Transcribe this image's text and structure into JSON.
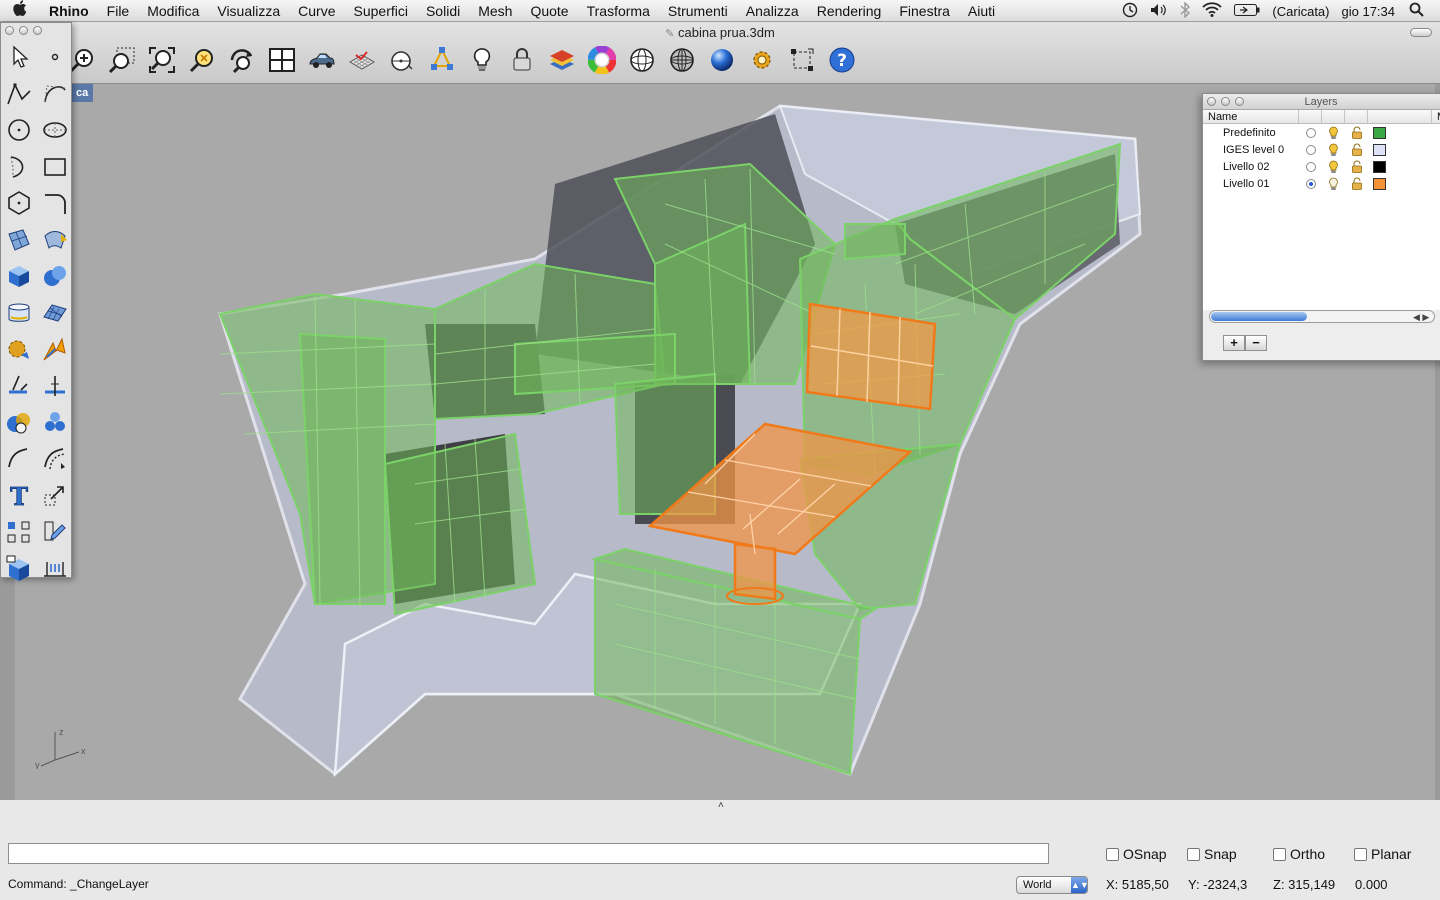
{
  "menubar": {
    "apple_icon": "apple-logo-icon",
    "items": [
      "Rhino",
      "File",
      "Modifica",
      "Visualizza",
      "Curve",
      "Superfici",
      "Solidi",
      "Mesh",
      "Quote",
      "Trasforma",
      "Strumenti",
      "Analizza",
      "Rendering",
      "Finestra",
      "Aiuti"
    ],
    "status": {
      "battery": "(Caricata)",
      "clock": "gio 17:34"
    }
  },
  "window": {
    "title": "cabina prua.3dm"
  },
  "toolbar": {
    "icons": [
      "zoom-in-icon",
      "zoom-window-icon",
      "zoom-extents-icon",
      "zoom-selected-icon",
      "rotate-view-icon",
      "four-viewports-icon",
      "shaded-car-icon",
      "grid-plane-icon",
      "osnap-target-icon",
      "gumball-icon",
      "lightbulb-icon",
      "lock-icon",
      "layer-stack-icon",
      "color-wheel-icon",
      "sphere-wireframe-icon",
      "sphere-ghosted-icon",
      "render-sphere-icon",
      "settings-gear-icon",
      "record-history-icon",
      "help-icon"
    ]
  },
  "viewport": {
    "label": "ca",
    "axis_labels": {
      "z": "z",
      "x": "x",
      "y": "y"
    }
  },
  "side_toolbar": {
    "icons": [
      "select-arrow-icon",
      "point-icon",
      "polyline-icon",
      "curve-icon",
      "circle-icon",
      "ellipse-icon",
      "arc-icon",
      "rectangle-icon",
      "polygon-icon",
      "fillet-icon",
      "surface-corner-icon",
      "surface-loft-icon",
      "box-solid-icon",
      "boolean-union-icon",
      "cylinder-icon",
      "mesh-plane-icon",
      "solid-tools-icon",
      "explode-icon",
      "trim-icon",
      "split-icon",
      "boolean-icon",
      "group-icon",
      "curve-from-object-icon",
      "offset-icon",
      "text-icon",
      "scale-icon",
      "array-icon",
      "transform-icon",
      "cplane-box-icon",
      "dimension-icon"
    ]
  },
  "layers": {
    "title": "Layers",
    "columns": {
      "name": "Name",
      "material": "Ma"
    },
    "rows": [
      {
        "name": "Predefinito",
        "current": false,
        "color": "#3aa845",
        "lamp": "on"
      },
      {
        "name": "IGES level 0",
        "current": false,
        "color": "#dde2f7",
        "lamp": "on"
      },
      {
        "name": "Livello 02",
        "current": false,
        "color": "#000000",
        "lamp": "on"
      },
      {
        "name": "Livello 01",
        "current": true,
        "color": "#f39234",
        "lamp": "off"
      }
    ],
    "add_label": "+",
    "remove_label": "−"
  },
  "bottom": {
    "toggles": [
      "OSnap",
      "Snap",
      "Ortho",
      "Planar"
    ],
    "command_text": "Command:  _ChangeLayer",
    "cplane": "World",
    "coords": {
      "x": "X: 5185,50",
      "y": "Y: -2324,3",
      "z": "Z: 315,149",
      "d": "0.000"
    }
  }
}
